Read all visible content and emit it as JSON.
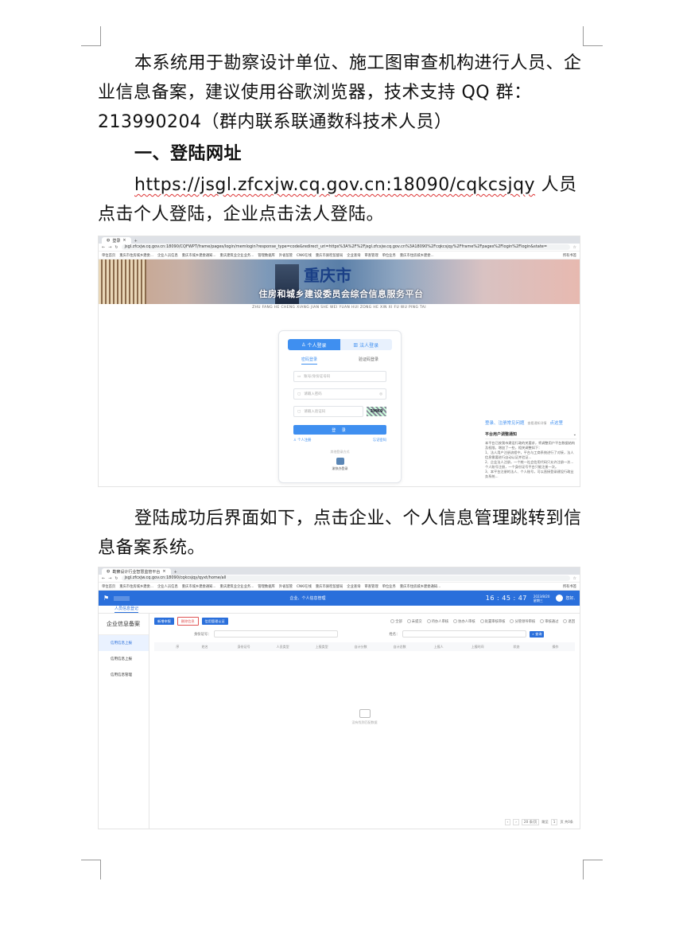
{
  "paragraph1": "本系统用于勘察设计单位、施工图审查机构进行人员、企业信息备案，建议使用谷歌浏览器，技术支持 QQ 群：213990204（群内联系联通数科技术人员）",
  "heading1": "一、登陆网址",
  "para2": {
    "url": "https://jsgl.zfcxjw.cq.gov.cn:18090/cqkcsjqy",
    "rest": " 人员点击个人登陆，企业点击法人登陆。"
  },
  "paragraph3": "登陆成功后界面如下，点击企业、个人信息管理跳转到信息备案系统。",
  "screenshot1": {
    "tab_title": "登录",
    "address": "jsgl.zfcxjw.cq.gov.cn:18090/CQFWPT/frame/pages/login/memlogin?response_type=code&redirect_uri=https%3A%2F%2Fjsgl.zfcxjw.cq.gov.cn%3A18090%2Fcqkcsjqy%2Fframe%2Fpages%2Flogin%2Flogin&state=",
    "bookmarks": [
      "单位首页",
      "重庆市住房城乡建委...",
      "企业人员信息",
      "重庆市城乡建委通知...",
      "重庆建筑业企业业务...",
      "管理数据库",
      "外省监管",
      "CNKI在线",
      "重庆市质检监督局",
      "企业查询",
      "审查管理",
      "单位业务",
      "重庆市住房城乡建委..."
    ],
    "bookmark_right": "所有书签",
    "banner_city": "重庆市",
    "banner_platform": "住房和城乡建设委员会综合信息服务平台",
    "banner_pinyin": "ZHU FANG HE CHENG XIANG JIAN SHE WEI YUAN HUI ZONG HE XIN XI FU WU PING TAI",
    "login_tab_personal": "个人登录",
    "login_tab_legal": "法人登录",
    "subtab_password": "密码登录",
    "subtab_sms": "验证码登录",
    "placeholder_account": "账号/身份证号码",
    "placeholder_password": "请输入密码",
    "placeholder_captcha": "请输入验证码",
    "captcha_text": "3MK9",
    "login_button": "登 录",
    "link_register": "个人注册",
    "link_forgot": "忘记密码",
    "other_methods": "其他登录方式",
    "other_label": "渝快办登录",
    "notice_link1": "登录、注册常见问题",
    "notice_link2": "查看通知详情",
    "notice_link3": "点这里",
    "notice_title": "平台用户调整通知",
    "notice_lines": [
      "本平台已按我市建设行政的关要求，将调整用户平台数据结构及权限，增加了一些，相关调整如下：",
      "1、法人用户注册流程中，平台与工商系统进行了对接，法人信息需要进行自动认证并验证...",
      "2、企业法人注册，一个统一社会信用代码只允许注册一次...",
      "个人账号注册，一个身份证号平台只能注册一次。",
      "3、本平台注册的法人、个人账号，可以直接登录建设行政业务系统..."
    ]
  },
  "screenshot2": {
    "tab_title": "勘察设计行业智慧监管平台",
    "address": "jsgl.zfcxjw.cq.gov.cn:18090/cqkcsjqy/qyxt/home/all",
    "bookmarks": [
      "单位首页",
      "重庆市住房城乡建委...",
      "企业人员信息",
      "重庆市城乡建委通知...",
      "重庆建筑业企业业务...",
      "管理数据库",
      "外省监管",
      "CNKI在线",
      "重庆市质检监督局",
      "企业查询",
      "审查管理",
      "单位业务",
      "重庆市住房城乡建委通知..."
    ],
    "bookmark_right": "所有书签",
    "header_title": "企业、个人信息管理",
    "clock": "16 : 45 : 47",
    "date": "2023/8/20",
    "weekday": "星期三",
    "user_label": "您好,",
    "breadcrumb_tab": "人员信息登记",
    "sidebar_title": "企业信息备案",
    "sidebar_items": [
      "信用信息上报",
      "信用信息上报",
      "信用信息管理"
    ],
    "btn_new": "新增申报",
    "btn_delete": "删除信息",
    "btn_manage": "信用管理认证",
    "filters": [
      "全部",
      "未提交",
      "待办人审核",
      "协办人审核",
      "处置审核审核",
      "分管领导审核",
      "审核通过",
      "退回"
    ],
    "search_label_id": "身份证号：",
    "search_label_name": "姓名：",
    "query_button": "查询",
    "columns": [
      "",
      "序",
      "姓名",
      "身份证号",
      "人员类型",
      "上报类型",
      "自计分数",
      "自计总数",
      "上报人",
      "上报时间",
      "状态",
      "操作"
    ],
    "empty_text": "没有找到匹配数据",
    "pager": {
      "page_size": "20 条/页",
      "goto_label": "跳至",
      "page": "1",
      "total": "页   共0条"
    }
  }
}
